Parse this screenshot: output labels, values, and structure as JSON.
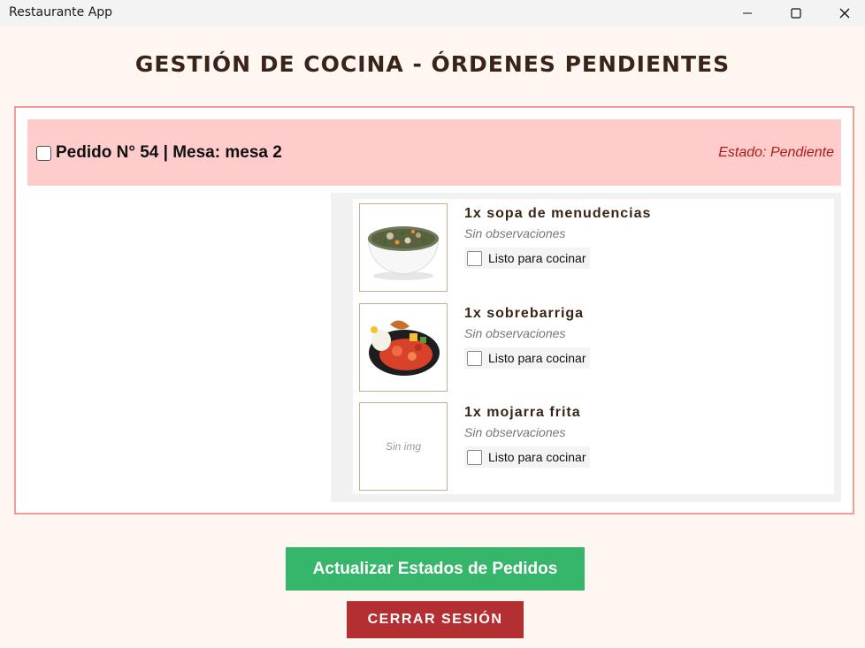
{
  "window": {
    "title": "Restaurante App"
  },
  "header": {
    "title": "GESTIÓN DE COCINA - ÓRDENES PENDIENTES"
  },
  "order": {
    "title": "Pedido N° 54 | Mesa: mesa 2",
    "status": "Estado: Pendiente",
    "items": [
      {
        "name": "1x sopa de menudencias",
        "observations": "Sin observaciones",
        "ready_label": "Listo para cocinar",
        "image": "soup-photo"
      },
      {
        "name": "1x sobrebarriga",
        "observations": "Sin observaciones",
        "ready_label": "Listo para cocinar",
        "image": "meat-dish-photo"
      },
      {
        "name": "1x mojarra frita",
        "observations": "Sin observaciones",
        "ready_label": "Listo para cocinar",
        "image_placeholder": "Sin img"
      }
    ]
  },
  "actions": {
    "update_label": "Actualizar Estados de Pedidos",
    "logout_label": "CERRAR SESIÓN"
  },
  "colors": {
    "update_button": "#35b66a",
    "logout_button": "#b32f32",
    "order_header": "#ffcccc",
    "status_text": "#b01818"
  }
}
